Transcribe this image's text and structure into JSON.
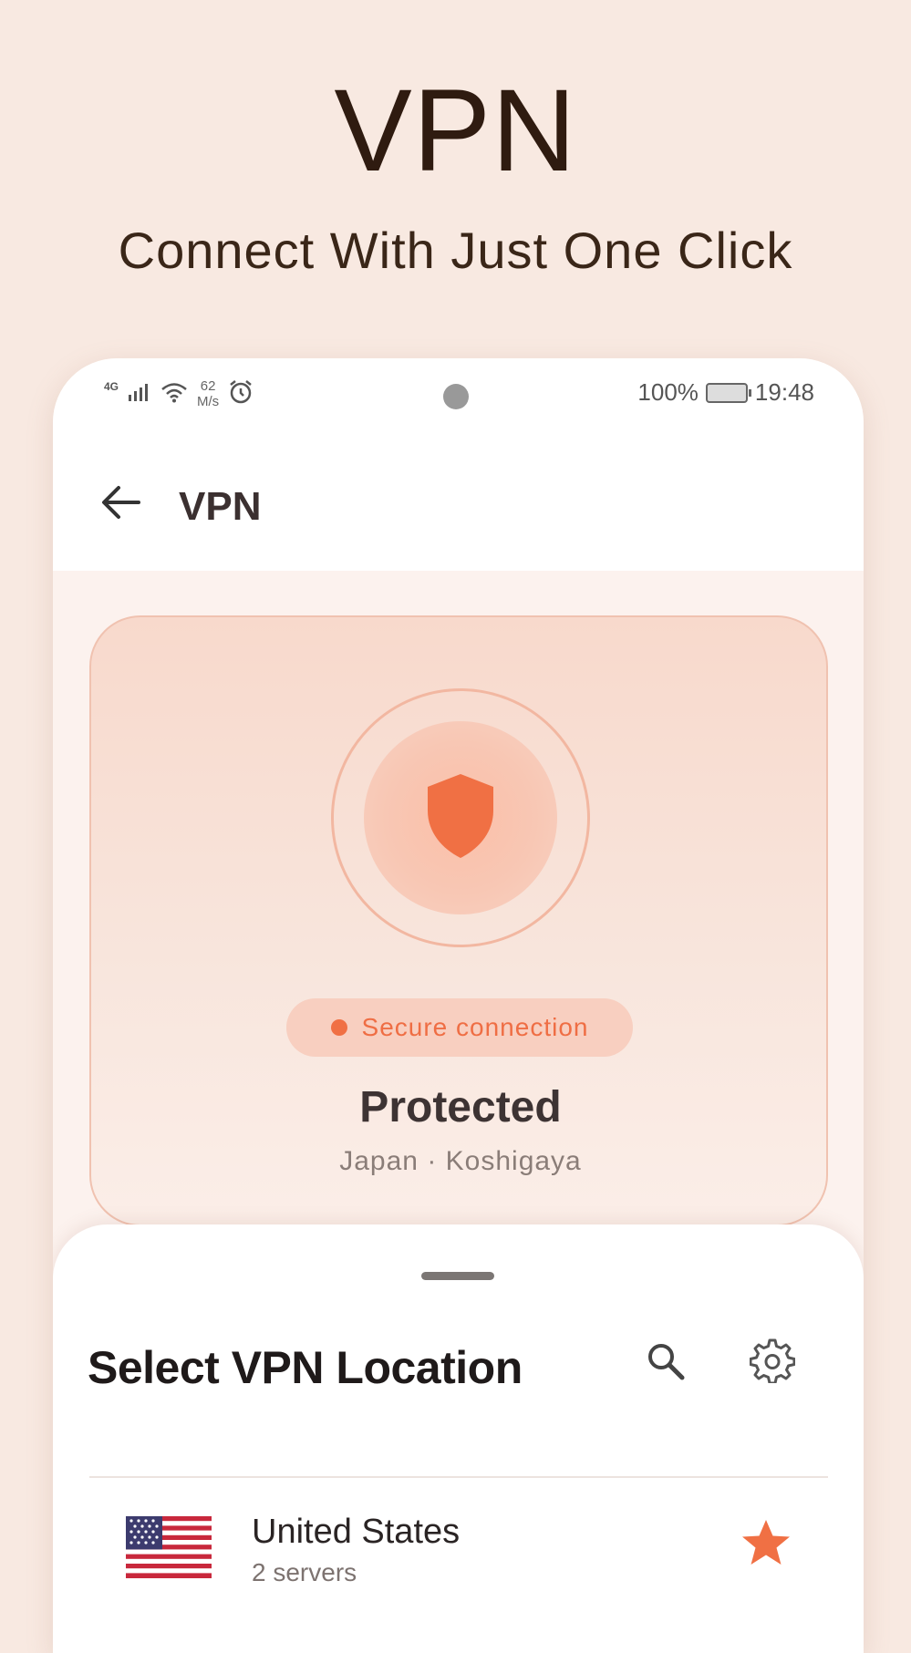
{
  "hero": {
    "title": "VPN",
    "subtitle": "Connect With Just One Click"
  },
  "status_bar": {
    "network": "4G",
    "speed_value": "62",
    "speed_unit": "M/s",
    "battery": "100%",
    "time": "19:48",
    "icons": [
      "signal-icon",
      "wifi-icon",
      "alarm-icon",
      "battery-icon"
    ]
  },
  "app_bar": {
    "title": "VPN",
    "back_icon": "arrow-left-icon"
  },
  "status_card": {
    "badge": "Secure connection",
    "state": "Protected",
    "location": "Japan · Koshigaya",
    "shield_icon": "shield-icon"
  },
  "sheet": {
    "title": "Select VPN Location",
    "search_icon": "search-icon",
    "settings_icon": "gear-icon",
    "locations": [
      {
        "country": "United States",
        "servers": "2 servers",
        "flag": "us-flag",
        "favorite": true
      }
    ]
  },
  "colors": {
    "accent": "#f07044",
    "background": "#f8e9e1",
    "card": "#f8d9cc"
  }
}
